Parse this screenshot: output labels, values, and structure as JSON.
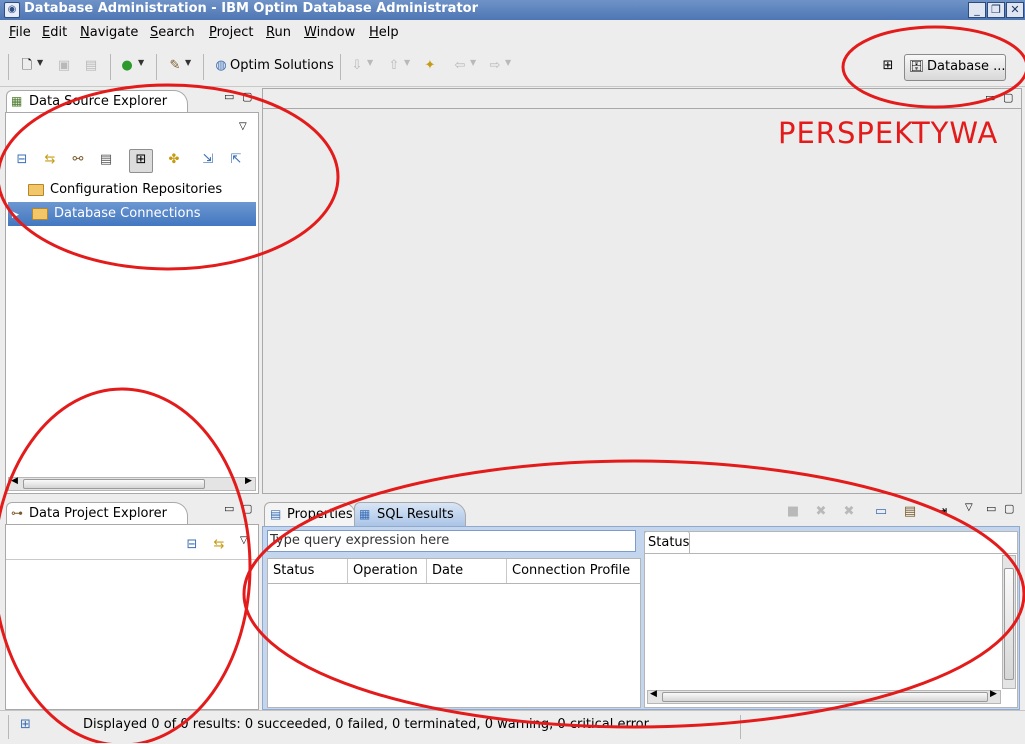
{
  "window": {
    "title": "Database Administration - IBM Optim Database Administrator",
    "controls": [
      "_",
      "❐",
      "✕"
    ]
  },
  "menu": [
    "File",
    "Edit",
    "Navigate",
    "Search",
    "Project",
    "Run",
    "Window",
    "Help"
  ],
  "menu_mnemonics": [
    "F",
    "E",
    "N",
    "S",
    "P",
    "R",
    "W",
    "H"
  ],
  "toolbar": {
    "optim_solutions_label": "Optim Solutions",
    "perspective_label": "Database ..."
  },
  "data_source_explorer": {
    "title": "Data Source Explorer",
    "tree": [
      {
        "label": "Configuration Repositories",
        "selected": false,
        "expandable": false
      },
      {
        "label": "Database Connections",
        "selected": true,
        "expandable": true
      }
    ]
  },
  "data_project_explorer": {
    "title": "Data Project Explorer"
  },
  "bottom_panel": {
    "tabs": [
      {
        "label": "Properties",
        "active": false
      },
      {
        "label": "SQL Results",
        "active": true
      }
    ],
    "filter_placeholder": "Type query expression here",
    "columns": [
      "Status",
      "Operation",
      "Date",
      "Connection Profile"
    ],
    "status_tab": "Status"
  },
  "status_bar": {
    "text": "Displayed 0 of 0 results: 0 succeeded, 0 failed, 0 terminated, 0 warning, 0 critical error"
  },
  "annotation": {
    "label": "PERSPEKTYWA",
    "color": "#e31b1b"
  },
  "colors": {
    "titlebar": "#5a80bd",
    "selection": "#4a7cc4",
    "annotation": "#e31b1b"
  }
}
